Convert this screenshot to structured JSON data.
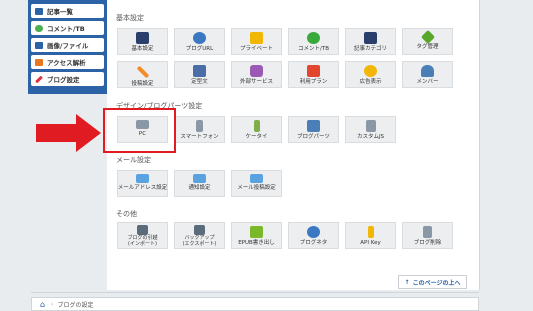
{
  "sidebar": {
    "items": [
      {
        "label": "記事一覧",
        "color": "#2b63a6"
      },
      {
        "label": "コメント/TB",
        "color": "#4caf50"
      },
      {
        "label": "画像/ファイル",
        "color": "#2b63a6"
      },
      {
        "label": "アクセス解析",
        "color": "#e87722"
      },
      {
        "label": "ブログ設定",
        "color": "#e0323d"
      }
    ]
  },
  "sections": {
    "basic": "基本設定",
    "design": "デザイン/ブログパーツ設定",
    "mail": "メール設定",
    "other": "その他"
  },
  "tiles": {
    "basic": [
      {
        "label": "基本設定",
        "icon": "house-icon",
        "color": "#2b3f6b"
      },
      {
        "label": "ブログURL",
        "icon": "www-icon",
        "color": "#3a78c2"
      },
      {
        "label": "プライベート",
        "icon": "lock-icon",
        "color": "#f2b705"
      },
      {
        "label": "コメント/TB",
        "icon": "speech-bubble-icon",
        "color": "#3aa83a"
      },
      {
        "label": "記事カテゴリ",
        "icon": "folder-icon",
        "color": "#2b3f6b"
      },
      {
        "label": "タグ管理",
        "icon": "tag-icon",
        "color": "#5aa82a"
      },
      {
        "label": "投稿設定",
        "icon": "pencil-icon",
        "color": "#f28c28"
      },
      {
        "label": "定型文",
        "icon": "document-icon",
        "color": "#4a6da8"
      },
      {
        "label": "外部サービス",
        "icon": "puzzle-icon",
        "color": "#9b59b6"
      },
      {
        "label": "利用プラン",
        "icon": "card-icon",
        "color": "#e2462f"
      },
      {
        "label": "広告表示",
        "icon": "coin-icon",
        "color": "#f2b705"
      },
      {
        "label": "メンバー",
        "icon": "users-icon",
        "color": "#4a7fb8"
      }
    ],
    "design": [
      {
        "label": "PC",
        "icon": "monitor-icon",
        "color": "#8a97a6"
      },
      {
        "label": "スマートフォン",
        "icon": "smartphone-icon",
        "color": "#8a97a6"
      },
      {
        "label": "ケータイ",
        "icon": "mobile-phone-icon",
        "color": "#7fae4a"
      },
      {
        "label": "ブログパーツ",
        "icon": "blocks-icon",
        "color": "#4a7fb8"
      },
      {
        "label": "カスタムJS",
        "icon": "js-file-icon",
        "color": "#8a97a6"
      }
    ],
    "mail": [
      {
        "label": "メールアドレス設定",
        "icon": "envelope-icon",
        "color": "#5ba3e0"
      },
      {
        "label": "通知設定",
        "icon": "envelope-alert-icon",
        "color": "#5ba3e0"
      },
      {
        "label": "メール投稿設定",
        "icon": "envelope-send-icon",
        "color": "#5ba3e0"
      }
    ],
    "other": [
      {
        "label": "ブログの引越\n(インポート)",
        "icon": "import-icon",
        "color": "#5a6b7c"
      },
      {
        "label": "バックアップ\n(エクスポート)",
        "icon": "backup-icon",
        "color": "#5a6b7c"
      },
      {
        "label": "EPUB書き出し",
        "icon": "epub-icon",
        "color": "#7ab829"
      },
      {
        "label": "ブログネタ",
        "icon": "chat-icon",
        "color": "#3a78c2"
      },
      {
        "label": "API Key",
        "icon": "key-icon",
        "color": "#f2b705"
      },
      {
        "label": "ブログ削除",
        "icon": "trash-icon",
        "color": "#8a97a6"
      }
    ]
  },
  "page_top_button": "このページの上へ",
  "breadcrumb": "ブログの設定"
}
